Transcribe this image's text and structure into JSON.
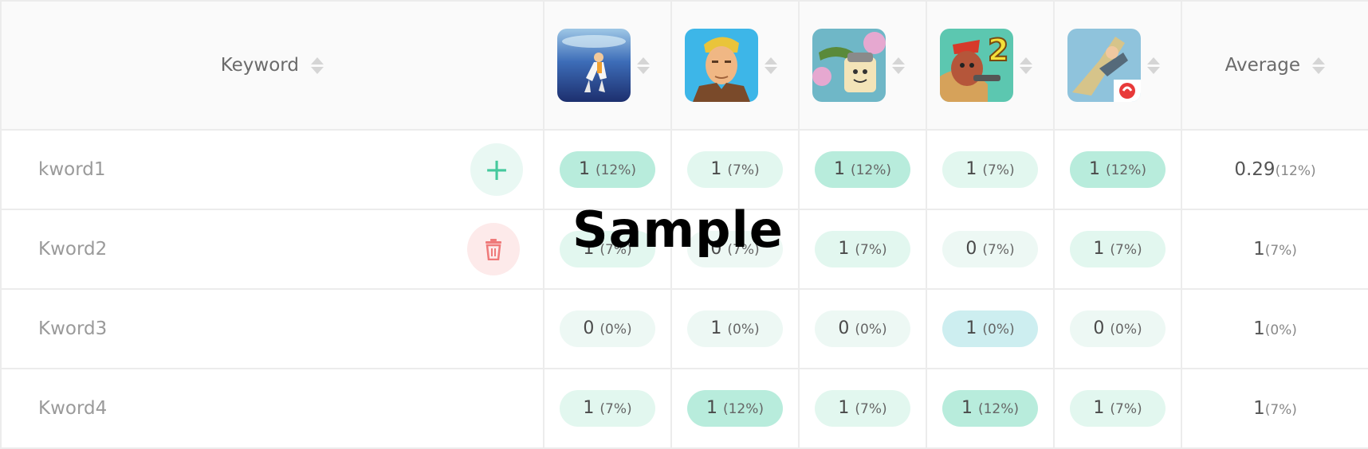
{
  "header": {
    "keyword_label": "Keyword",
    "average_label": "Average",
    "games": [
      {
        "icon": "game-icon-diver"
      },
      {
        "icon": "game-icon-fortnite"
      },
      {
        "icon": "game-icon-cartoon-knight"
      },
      {
        "icon": "game-icon-hero-2"
      },
      {
        "icon": "game-icon-free-fire"
      }
    ]
  },
  "rows": [
    {
      "keyword": "kword1",
      "action": "add",
      "cells": [
        {
          "value": "1",
          "pct": "(12%)",
          "level": "high"
        },
        {
          "value": "1",
          "pct": "(7%)",
          "level": "low"
        },
        {
          "value": "1",
          "pct": "(12%)",
          "level": "high"
        },
        {
          "value": "1",
          "pct": "(7%)",
          "level": "low"
        },
        {
          "value": "1",
          "pct": "(12%)",
          "level": "high"
        }
      ],
      "average": {
        "value": "0.29",
        "pct": "(12%)"
      }
    },
    {
      "keyword": "Kword2",
      "action": "delete",
      "cells": [
        {
          "value": "1",
          "pct": "(7%)",
          "level": "low"
        },
        {
          "value": "0",
          "pct": "(7%)",
          "level": "none"
        },
        {
          "value": "1",
          "pct": "(7%)",
          "level": "low"
        },
        {
          "value": "0",
          "pct": "(7%)",
          "level": "none"
        },
        {
          "value": "1",
          "pct": "(7%)",
          "level": "low"
        }
      ],
      "average": {
        "value": "1",
        "pct": "(7%)"
      }
    },
    {
      "keyword": "Kword3",
      "action": "",
      "cells": [
        {
          "value": "0",
          "pct": "(0%)",
          "level": "none"
        },
        {
          "value": "1",
          "pct": "(0%)",
          "level": "none"
        },
        {
          "value": "0",
          "pct": "(0%)",
          "level": "none"
        },
        {
          "value": "1",
          "pct": "(0%)",
          "level": "blue"
        },
        {
          "value": "0",
          "pct": "(0%)",
          "level": "none"
        }
      ],
      "average": {
        "value": "1",
        "pct": "(0%)"
      }
    },
    {
      "keyword": "Kword4",
      "action": "",
      "cells": [
        {
          "value": "1",
          "pct": "(7%)",
          "level": "low"
        },
        {
          "value": "1",
          "pct": "(12%)",
          "level": "high"
        },
        {
          "value": "1",
          "pct": "(7%)",
          "level": "low"
        },
        {
          "value": "1",
          "pct": "(12%)",
          "level": "high"
        },
        {
          "value": "1",
          "pct": "(7%)",
          "level": "low"
        }
      ],
      "average": {
        "value": "1",
        "pct": "(7%)"
      }
    }
  ],
  "watermark": "Sample",
  "colors": {
    "accent": "#45c99d",
    "danger": "#ef7a7a"
  }
}
